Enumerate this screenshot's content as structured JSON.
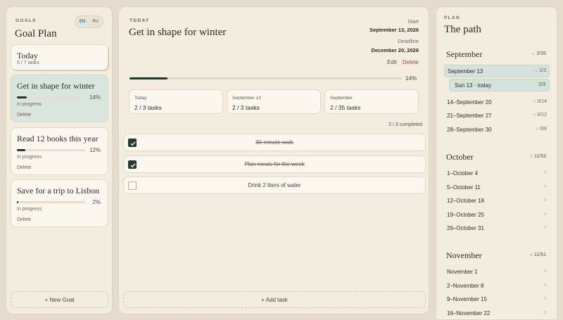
{
  "sidebar": {
    "kicker": "GOALS",
    "title": "Goal Plan",
    "languages": [
      "EN",
      "RU"
    ],
    "active_language": "EN",
    "today_card": {
      "title": "Today",
      "subtitle": "5 / 7 tasks"
    },
    "goals": [
      {
        "title": "Get in shape for winter",
        "percent": "14%",
        "progress": 0.14,
        "status": "In progress",
        "delete_label": "Delete",
        "selected": true
      },
      {
        "title": "Read 12 books this year",
        "percent": "12%",
        "progress": 0.12,
        "status": "In progress",
        "delete_label": "Delete",
        "selected": false
      },
      {
        "title": "Save for a trip to Lisbon",
        "percent": "2%",
        "progress": 0.02,
        "status": "In progress",
        "delete_label": "Delete",
        "selected": false
      }
    ],
    "new_goal_label": "+ New Goal"
  },
  "main": {
    "kicker": "TODAY",
    "goal_title": "Get in shape for winter",
    "start_label": "Start",
    "start_value": "September 13, 2026",
    "deadline_label": "Deadline",
    "deadline_value": "December 20, 2026",
    "edit_label": "Edit",
    "delete_label": "Delete",
    "progress": 0.14,
    "progress_text": "14%",
    "stats": [
      {
        "label": "Today",
        "value": "2 / 3 tasks"
      },
      {
        "label": "September 13",
        "value": "2 / 3 tasks"
      },
      {
        "label": "September",
        "value": "2 / 35 tasks"
      }
    ],
    "today_kicker": "TODAY",
    "completed_text": "2 / 3 completed",
    "tasks": [
      {
        "text": "30-minute walk",
        "done": true
      },
      {
        "text": "Plan meals for the week",
        "done": true
      },
      {
        "text": "Drink 2 liters of water",
        "done": false
      }
    ],
    "add_task_label": "+ Add task"
  },
  "plan": {
    "kicker": "PLAN",
    "title": "The path",
    "months": [
      {
        "name": "September",
        "count": "→ 2/35",
        "weeks": [
          {
            "label": "September 13",
            "count": "→ 2/3",
            "active": true
          },
          {
            "label": "Sun 13 · today",
            "count": "2/3",
            "day": true
          },
          {
            "label": "14–September 20",
            "count": "○ 0/14"
          },
          {
            "label": "21–September 27",
            "count": "○ 0/12"
          },
          {
            "label": "28–September 30",
            "count": "○ 0/6"
          }
        ]
      },
      {
        "name": "October",
        "count": "○ 11/53",
        "weeks": [
          {
            "label": "1–October 4",
            "count": "○"
          },
          {
            "label": "5–October 11",
            "count": "○"
          },
          {
            "label": "12–October 18",
            "count": "○"
          },
          {
            "label": "19–October 25",
            "count": "○"
          },
          {
            "label": "26–October 31",
            "count": "○"
          }
        ]
      },
      {
        "name": "November",
        "count": "○ 11/51",
        "weeks": [
          {
            "label": "November 1",
            "count": "○"
          },
          {
            "label": "2–November 8",
            "count": "○"
          },
          {
            "label": "9–November 15",
            "count": "○"
          },
          {
            "label": "16–November 22",
            "count": "○"
          }
        ]
      }
    ]
  }
}
